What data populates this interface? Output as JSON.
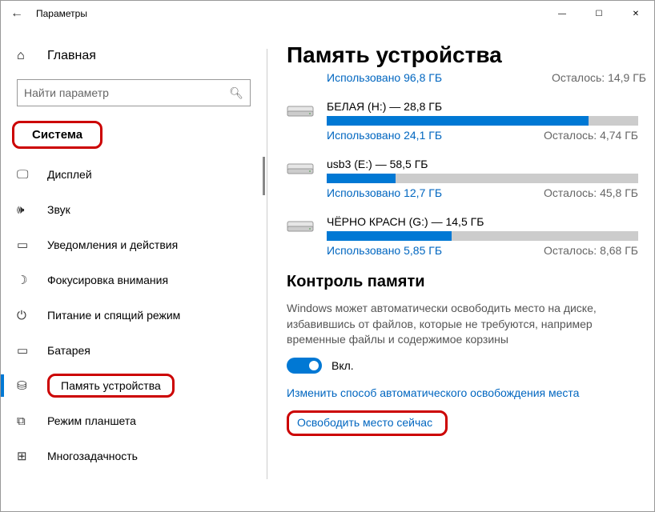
{
  "window": {
    "title": "Параметры"
  },
  "sidebar": {
    "home": "Главная",
    "search_placeholder": "Найти параметр",
    "section": "Система",
    "items": [
      {
        "label": "Дисплей"
      },
      {
        "label": "Звук"
      },
      {
        "label": "Уведомления и действия"
      },
      {
        "label": "Фокусировка внимания"
      },
      {
        "label": "Питание и спящий режим"
      },
      {
        "label": "Батарея"
      },
      {
        "label": "Память устройства"
      },
      {
        "label": "Режим планшета"
      },
      {
        "label": "Многозадачность"
      }
    ]
  },
  "main": {
    "title": "Память устройства",
    "drives": [
      {
        "name": "",
        "used_label": "Использовано 96,8 ГБ",
        "remain_label": "Осталось: 14,9 ГБ",
        "pct": 0,
        "no_bar": true
      },
      {
        "name": "БЕЛАЯ (H:) — 28,8 ГБ",
        "used_label": "Использовано 24,1 ГБ",
        "remain_label": "Осталось: 4,74 ГБ",
        "pct": 84
      },
      {
        "name": "usb3 (E:) — 58,5 ГБ",
        "used_label": "Использовано 12,7 ГБ",
        "remain_label": "Осталось: 45,8 ГБ",
        "pct": 22
      },
      {
        "name": "ЧЁРНО КРАСН (G:) — 14,5 ГБ",
        "used_label": "Использовано 5,85 ГБ",
        "remain_label": "Осталось: 8,68 ГБ",
        "pct": 40
      }
    ],
    "sense_title": "Контроль памяти",
    "sense_desc": "Windows может автоматически освободить место на диске, избавившись от файлов, которые не требуются, например временные файлы и содержимое корзины",
    "toggle_label": "Вкл.",
    "link_change": "Изменить способ автоматического освобождения места",
    "link_free": "Освободить место сейчас"
  }
}
